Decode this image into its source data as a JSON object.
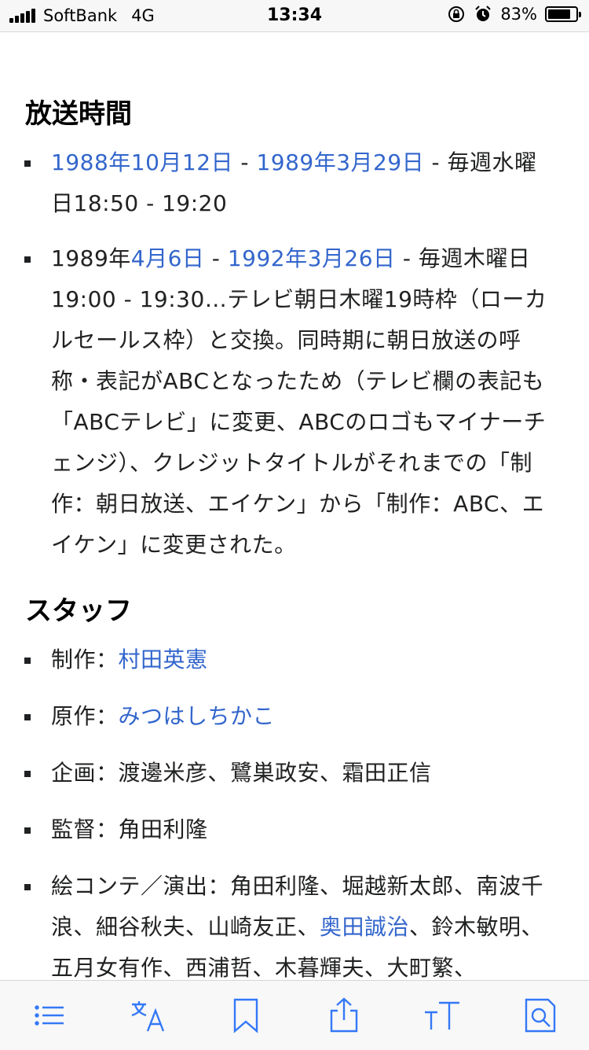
{
  "status": {
    "carrier": "SoftBank",
    "network": "4G",
    "time": "13:34",
    "battery": "83%",
    "battery_level": 0.83
  },
  "sections": {
    "broadcast": {
      "title": "放送時間",
      "items": [
        {
          "d1": "1988年10月12日",
          "s1": " - ",
          "d2": "1989年3月29日",
          "rest": " - 毎週水曜日18:50 - 19:20"
        },
        {
          "pre": "1989年",
          "d1": "4月6日",
          "s1": " - ",
          "d2": "1992年3月26日",
          "rest": " - 毎週木曜日19:00 - 19:30…テレビ朝日木曜19時枠（ローカルセールス枠）と交換。同時期に朝日放送の呼称・表記がABCとなったため（テレビ欄の表記も「ABCテレビ」に変更、ABCのロゴもマイナーチェンジ）、クレジットタイトルがそれまでの「制作：朝日放送、エイケン」から「制作：ABC、エイケン」に変更された。"
        }
      ]
    },
    "staff": {
      "title": "スタッフ",
      "items": [
        {
          "label": "制作：",
          "link": "村田英憲"
        },
        {
          "label": "原作：",
          "link": "みつはしちかこ"
        },
        {
          "text": "企画：渡邊米彦、鷺巣政安、霜田正信"
        },
        {
          "text": "監督：角田利隆"
        },
        {
          "pre": "絵コンテ／演出：角田利隆、堀越新太郎、南波千浪、細谷秋夫、山崎友正、",
          "link": "奥田誠治",
          "post": "、鈴木敏明、五月女有作、西浦哲、木暮輝夫、大町繁、"
        }
      ]
    }
  },
  "toolbar": {
    "items": [
      "list-icon",
      "translate-icon",
      "bookmark-icon",
      "share-icon",
      "text-size-icon",
      "search-icon"
    ]
  },
  "colors": {
    "link": "#3366cc",
    "text": "#202122",
    "toolbar_icon": "#3478f6"
  }
}
